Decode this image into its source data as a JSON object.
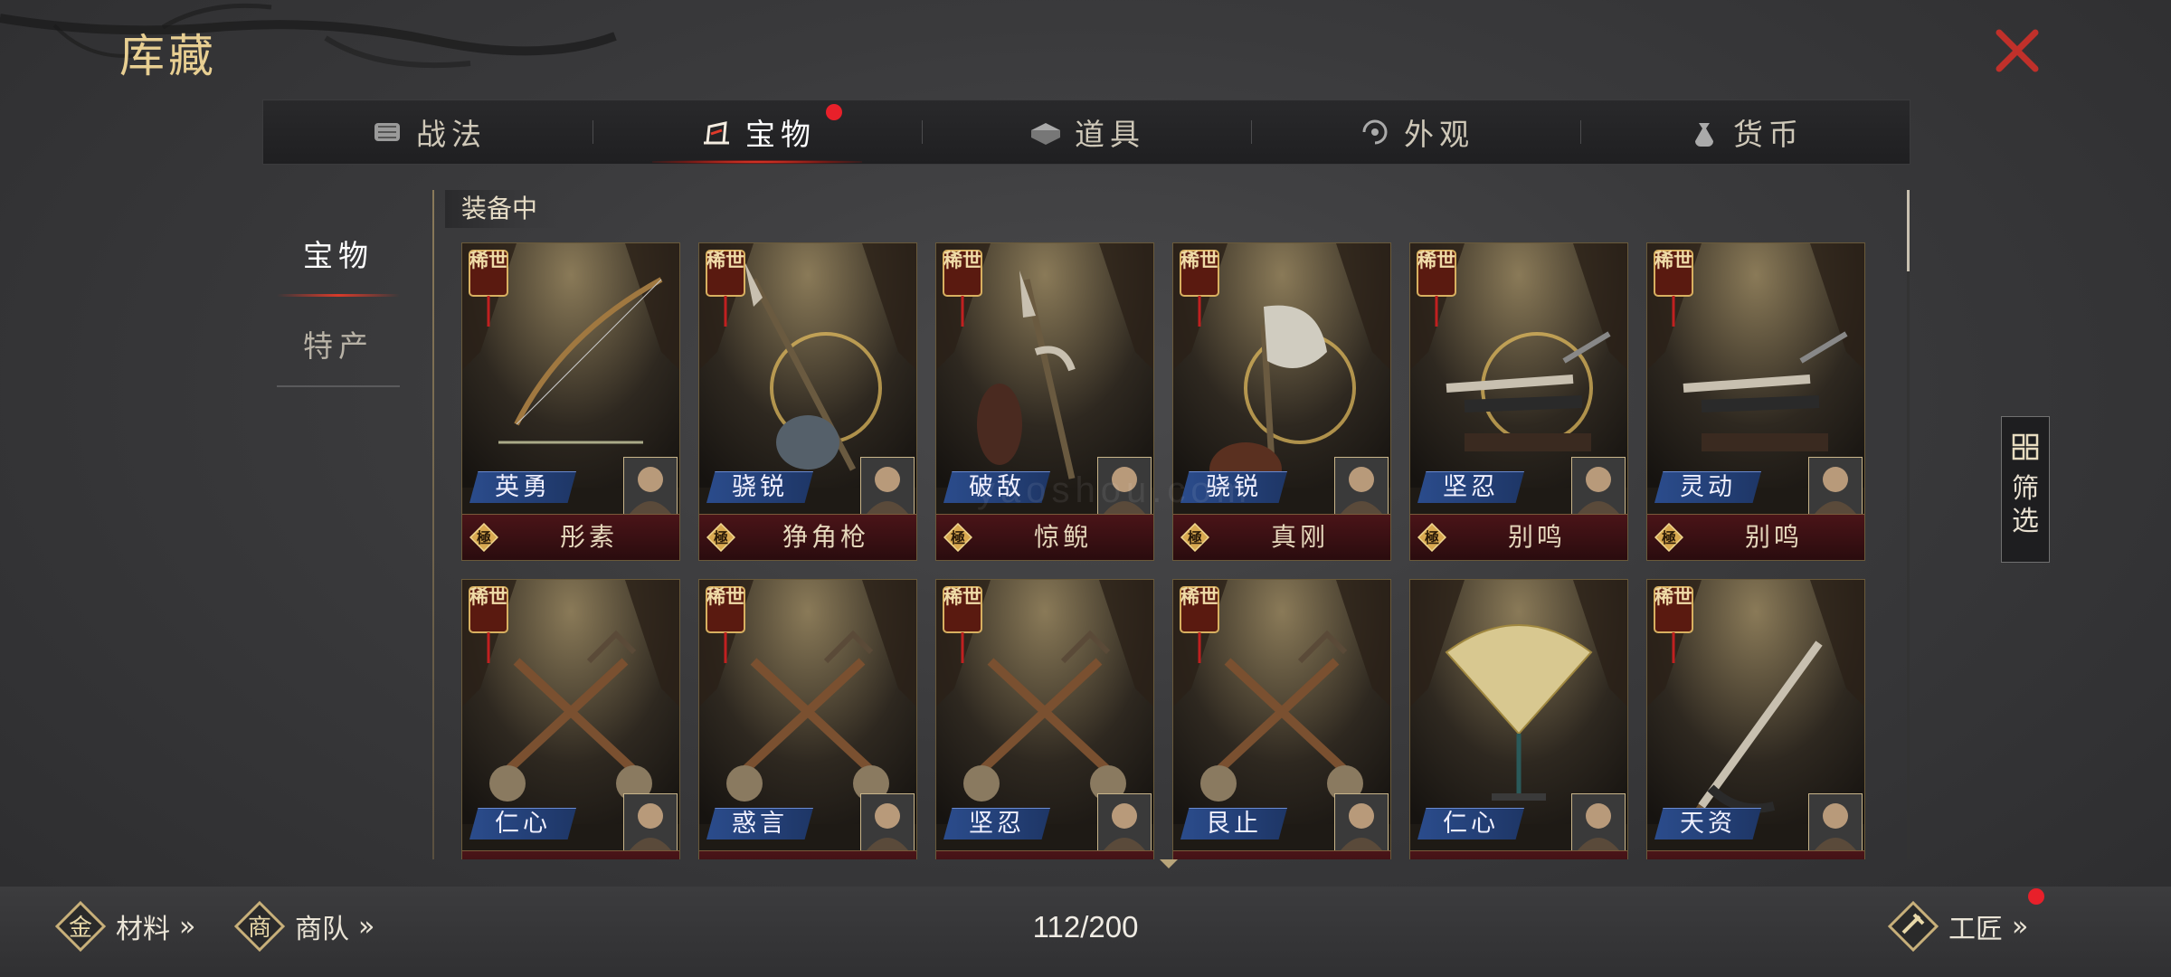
{
  "header": {
    "title": "库藏"
  },
  "tabs": [
    {
      "label": "战法",
      "icon": "scroll-icon",
      "active": false
    },
    {
      "label": "宝物",
      "icon": "treasure-icon",
      "active": true,
      "dot": true
    },
    {
      "label": "道具",
      "icon": "item-box-icon",
      "active": false
    },
    {
      "label": "外观",
      "icon": "appearance-icon",
      "active": false
    },
    {
      "label": "货币",
      "icon": "money-bag-icon",
      "active": false
    }
  ],
  "sidebar": {
    "items": [
      {
        "label": "宝物",
        "active": true
      },
      {
        "label": "特产",
        "active": false
      }
    ]
  },
  "section": {
    "label": "装备中"
  },
  "cards": [
    {
      "rare": "稀世",
      "skill": "英勇",
      "grade": "極",
      "name": "彤素",
      "weapon": "bow",
      "aura": false
    },
    {
      "rare": "稀世",
      "skill": "骁锐",
      "grade": "極",
      "name": "狰角枪",
      "weapon": "spear",
      "aura": true
    },
    {
      "rare": "稀世",
      "skill": "破敌",
      "grade": "極",
      "name": "惊鲵",
      "weapon": "halberd",
      "aura": false
    },
    {
      "rare": "稀世",
      "skill": "骁锐",
      "grade": "極",
      "name": "真刚",
      "weapon": "axe",
      "aura": true
    },
    {
      "rare": "稀世",
      "skill": "坚忍",
      "grade": "極",
      "name": "别鸣",
      "weapon": "sword",
      "aura": true
    },
    {
      "rare": "稀世",
      "skill": "灵动",
      "grade": "極",
      "name": "别鸣",
      "weapon": "sword",
      "aura": false
    },
    {
      "rare": "稀世",
      "skill": "仁心",
      "grade": "",
      "name": "",
      "weapon": "mace",
      "aura": false
    },
    {
      "rare": "稀世",
      "skill": "惑言",
      "grade": "",
      "name": "",
      "weapon": "mace",
      "aura": false
    },
    {
      "rare": "稀世",
      "skill": "坚忍",
      "grade": "",
      "name": "",
      "weapon": "mace",
      "aura": false
    },
    {
      "rare": "稀世",
      "skill": "艮止",
      "grade": "",
      "name": "",
      "weapon": "mace",
      "aura": false
    },
    {
      "rare": "",
      "skill": "仁心",
      "grade": "",
      "name": "",
      "weapon": "fan",
      "aura": false
    },
    {
      "rare": "稀世",
      "skill": "天资",
      "grade": "",
      "name": "",
      "weapon": "saber",
      "aura": false
    }
  ],
  "filter": {
    "label": "筛选",
    "icon": "filter-grid-icon"
  },
  "bottom": {
    "materials_label": "材料",
    "materials_icon_char": "金",
    "caravan_label": "商队",
    "caravan_icon_char": "商",
    "craftsman_label": "工匠",
    "count": "112/200"
  },
  "watermark": "yaoshou.com",
  "colors": {
    "accent_gold": "#e8cf92",
    "skill_blue": "#2b4c8c",
    "name_red": "#4a1418",
    "notify_red": "#e8202a"
  }
}
